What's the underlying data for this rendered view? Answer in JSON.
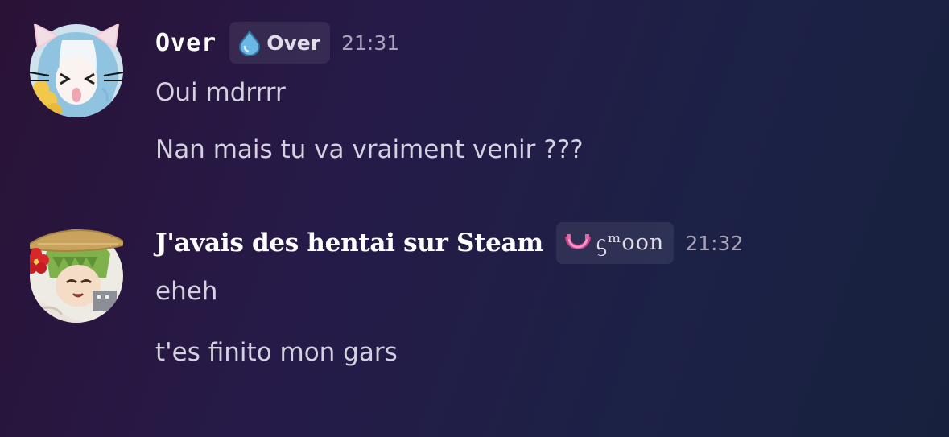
{
  "messages": [
    {
      "author": "Over",
      "tag_label": "Over",
      "tag_icon": "water-drop-icon",
      "time": "21:31",
      "lines": [
        "Oui mdrrrr",
        "Nan mais tu va vraiment venir ???"
      ]
    },
    {
      "author": "J'avais des hentai sur Steam",
      "tag_label": "ᦓᵐoon",
      "tag_icon": "pink-ring-icon",
      "time": "21:32",
      "lines": [
        "eheh",
        "t'es finito mon gars"
      ]
    }
  ]
}
